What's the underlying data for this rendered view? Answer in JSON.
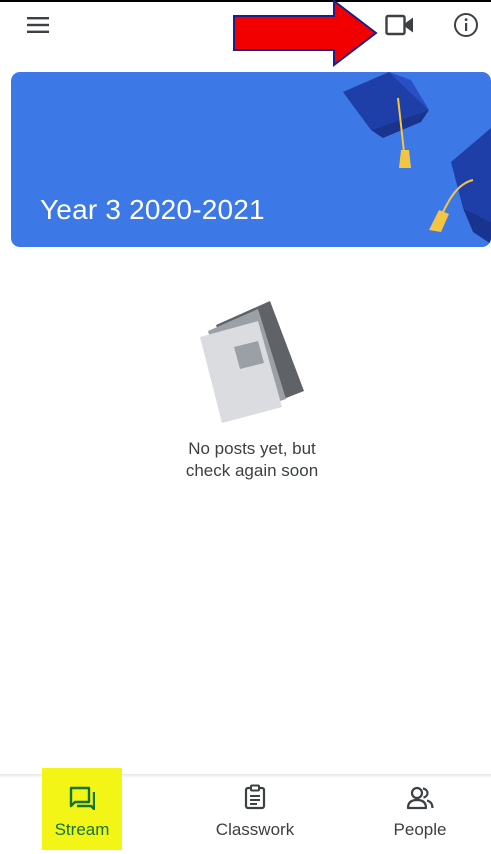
{
  "header": {
    "menu_icon": "hamburger-menu-icon",
    "video_icon": "video-camera-icon",
    "info_icon": "info-icon"
  },
  "annotation": {
    "arrow_color": "#f20000",
    "highlight_color": "#f3f516"
  },
  "banner": {
    "title": "Year 3 2020-2021",
    "background_color": "#3c78e6"
  },
  "stream": {
    "empty_line1": "No posts yet, but",
    "empty_line2": "check again soon"
  },
  "bottom_nav": {
    "items": [
      {
        "label": "Stream",
        "icon": "stream-icon",
        "active": true
      },
      {
        "label": "Classwork",
        "icon": "classwork-icon",
        "active": false
      },
      {
        "label": "People",
        "icon": "people-icon",
        "active": false
      }
    ],
    "active_color": "#137333"
  }
}
